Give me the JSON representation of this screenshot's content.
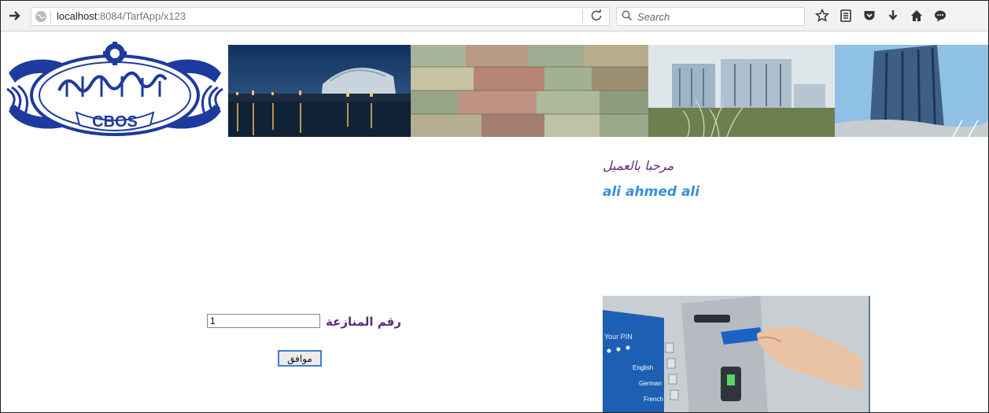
{
  "browser": {
    "url_host": "localhost",
    "url_rest": ":8084/TarfApp/x123",
    "search_placeholder": "Search"
  },
  "banner": {
    "logo_text": "CBOS",
    "logo_name": "central-bank-of-sudan-logo"
  },
  "greeting": {
    "welcome": "مرحبا بالعميل",
    "customer_name": "ali ahmed ali"
  },
  "form": {
    "dispute_label": "رقم المنازعة",
    "dispute_value": "1",
    "submit_label": "موافق"
  },
  "atm_screen": {
    "pin_text": "Your PIN",
    "options": [
      "English",
      "German",
      "French"
    ]
  },
  "colors": {
    "label_purple": "#5a2a82",
    "name_blue": "#3a8fd8",
    "button_border": "#3b7ed8"
  }
}
